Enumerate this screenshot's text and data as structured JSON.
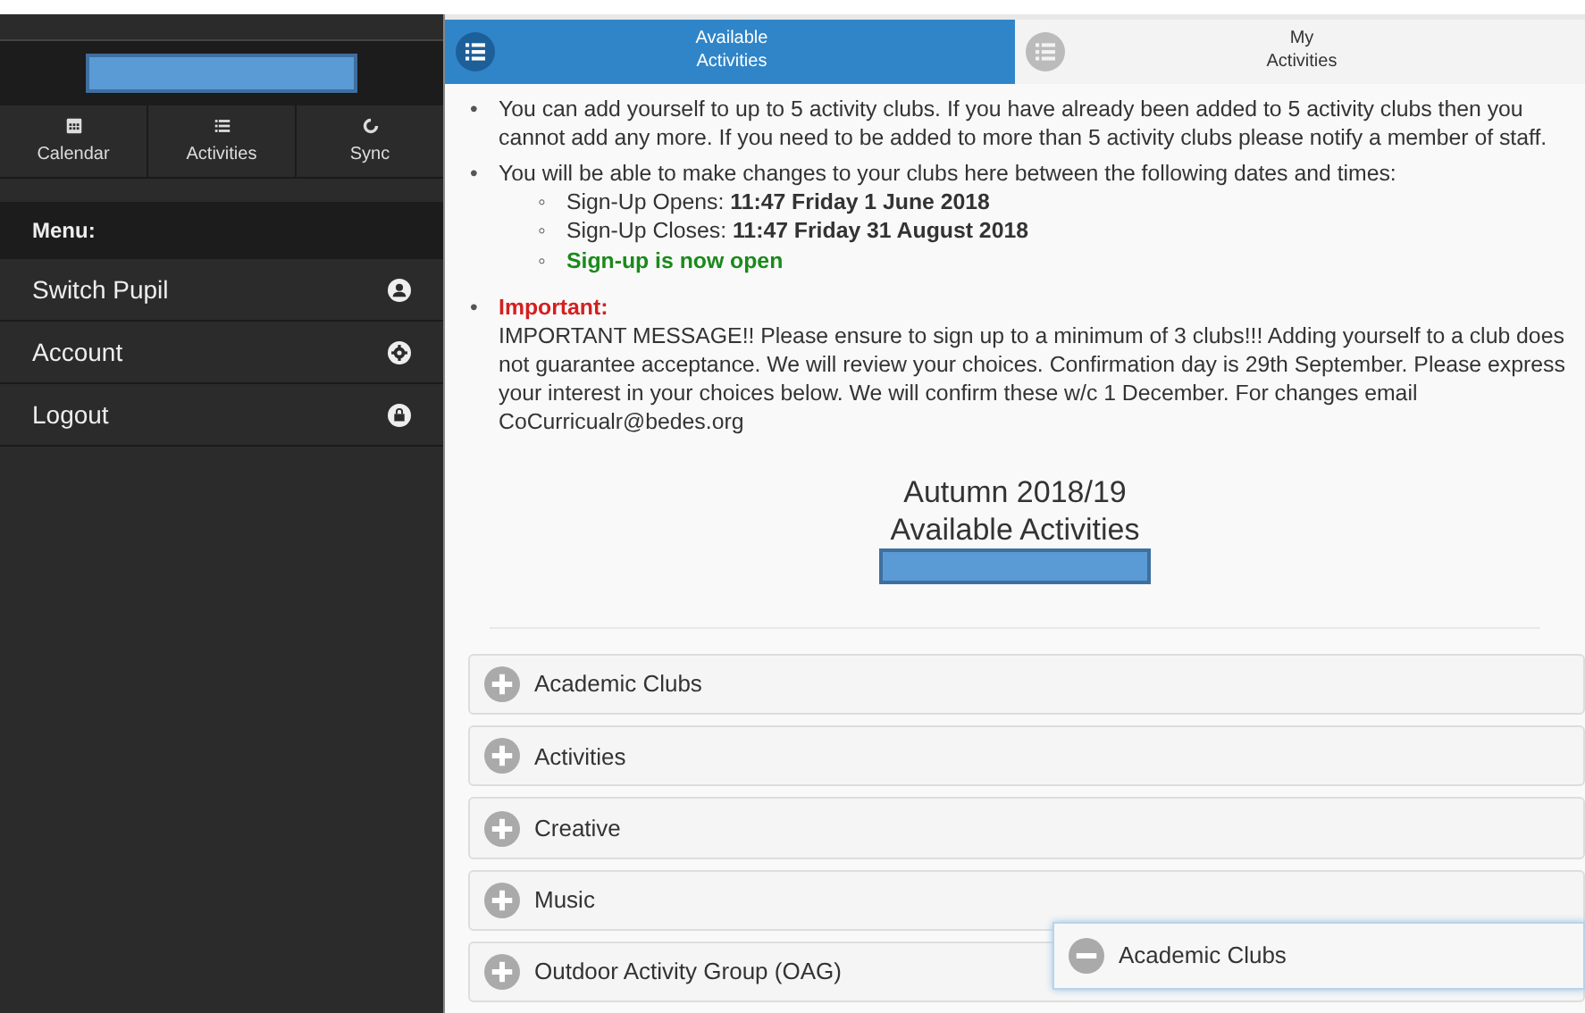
{
  "sidebar": {
    "nav_buttons": [
      {
        "label": "Calendar"
      },
      {
        "label": "Activities"
      },
      {
        "label": "Sync"
      }
    ],
    "menu_title": "Menu:",
    "menu_items": [
      {
        "label": "Switch Pupil"
      },
      {
        "label": "Account"
      },
      {
        "label": "Logout"
      }
    ]
  },
  "tabs": [
    {
      "label": "Available\nActivities",
      "selected": true
    },
    {
      "label": "My\nActivities",
      "selected": false
    }
  ],
  "info": [
    {
      "kind": "text",
      "marker": "•",
      "text": "You can add yourself to up to 5 activity clubs. If you have already been added to 5 activity clubs then you cannot add any more. If you need to be added to more than 5 activity clubs please notify a member of staff."
    },
    {
      "kind": "text",
      "marker": "•",
      "text": "You will be able to make changes to your clubs here between the following dates and times:",
      "subitems": [
        {
          "kind": "date",
          "marker": "◦",
          "text": "Sign-Up Opens: **11:47 Friday 1 June 2018**"
        },
        {
          "kind": "date",
          "marker": "◦",
          "text": "Sign-Up Closes: **11:47 Friday 31 August 2018**"
        },
        {
          "kind": "status",
          "marker": "◦",
          "text": "**Sign-up is now open**"
        }
      ]
    },
    {
      "kind": "important",
      "marker": "•",
      "heading": "Important:",
      "text": "IMPORTANT MESSAGE!! Please ensure to sign up to a minimum of 3 clubs!!! Adding yourself to a club does not guarantee acceptance. We will review your choices. Confirmation day is 29th September. Please express your interest in your choices below. We will confirm these w/c 1 December. For changes email CoCurricualr@bedes.org"
    }
  ],
  "heading": [
    "Autumn 2018/19",
    "Available Activities"
  ],
  "categories": [
    {
      "label": "Academic Clubs",
      "expanded": false
    },
    {
      "label": "Activities",
      "expanded": false
    },
    {
      "label": "Creative",
      "expanded": false
    },
    {
      "label": "Music",
      "expanded": false
    },
    {
      "label": "Outdoor Activity Group (OAG)",
      "expanded": false
    }
  ],
  "floating_panel": {
    "label": "Academic Clubs",
    "expanded": true
  }
}
